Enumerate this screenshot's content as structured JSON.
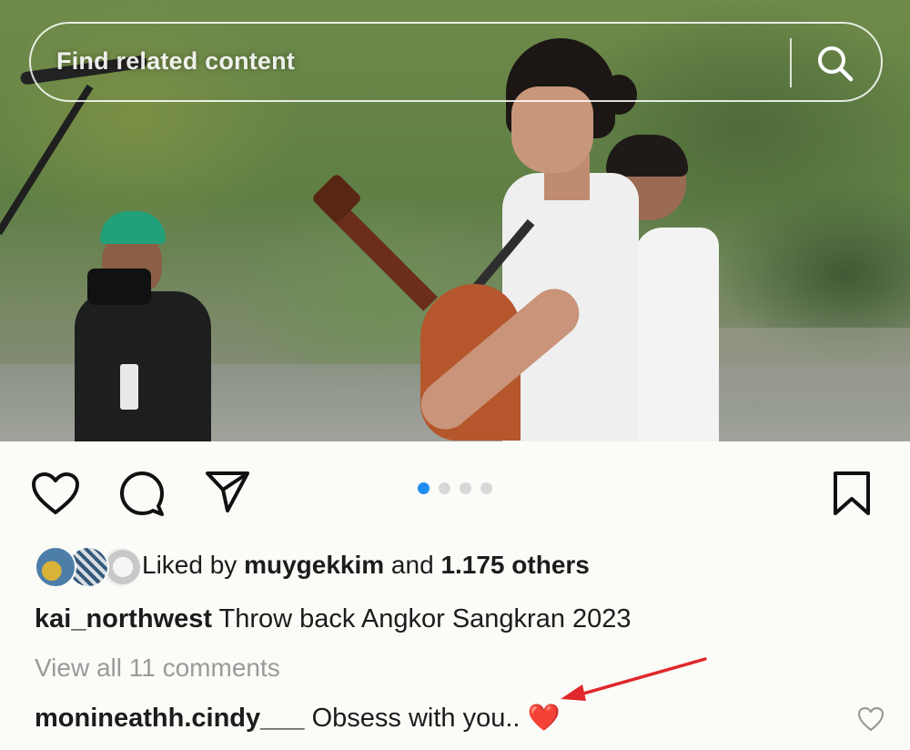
{
  "search": {
    "placeholder": "Find related content"
  },
  "post": {
    "carousel": {
      "total": 4,
      "active_index": 0
    },
    "likes": {
      "prefix": "Liked by ",
      "user": "muygekkim",
      "middle": " and ",
      "count": "1.175 others"
    },
    "caption": {
      "username": "kai_northwest",
      "text": " Throw back Angkor Sangkran 2023"
    },
    "view_comments": "View all 11 comments",
    "comment": {
      "username": "monineathh.cindy___",
      "text": " Obsess with you.. ",
      "emoji": "❤️"
    }
  },
  "icons": [
    "search-icon",
    "heart-icon",
    "comment-icon",
    "share-icon",
    "bookmark-icon",
    "comment-like-icon"
  ],
  "colors": {
    "accent_dot": "#1e8ef0",
    "annotation_arrow": "#e0272b",
    "muted_text": "#9a9a9a"
  }
}
